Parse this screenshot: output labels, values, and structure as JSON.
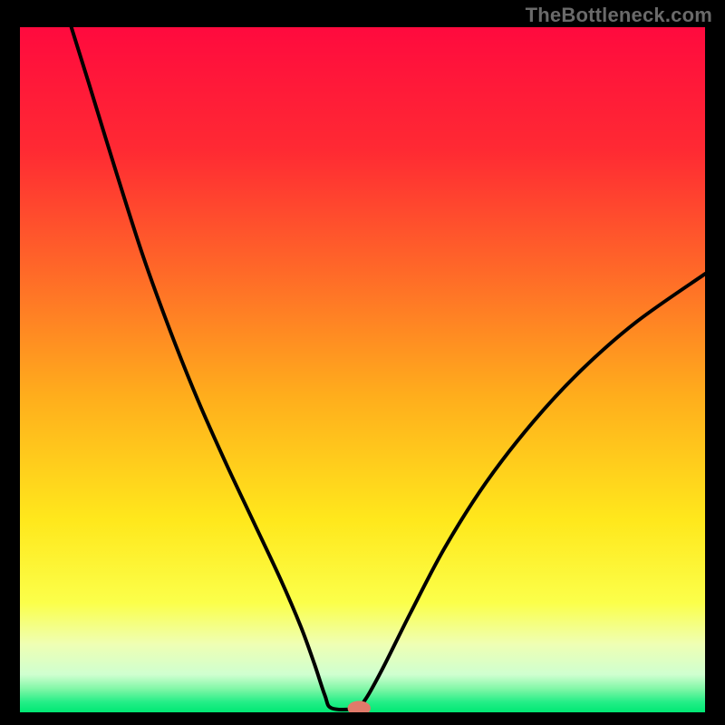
{
  "watermark": "TheBottleneck.com",
  "colors": {
    "frame_bg": "#000000",
    "gradient_stops": [
      {
        "offset": 0.0,
        "color": "#ff0a3e"
      },
      {
        "offset": 0.18,
        "color": "#ff2a33"
      },
      {
        "offset": 0.36,
        "color": "#ff6a28"
      },
      {
        "offset": 0.54,
        "color": "#ffae1c"
      },
      {
        "offset": 0.72,
        "color": "#ffe81c"
      },
      {
        "offset": 0.84,
        "color": "#fbff4a"
      },
      {
        "offset": 0.9,
        "color": "#efffb3"
      },
      {
        "offset": 0.945,
        "color": "#cfffd0"
      },
      {
        "offset": 0.965,
        "color": "#84f7a8"
      },
      {
        "offset": 0.985,
        "color": "#24ee87"
      },
      {
        "offset": 1.0,
        "color": "#00e874"
      }
    ],
    "curve_stroke": "#000000",
    "marker_fill": "#e07a6a",
    "marker_stroke": "#e07a6a"
  },
  "chart_data": {
    "type": "line",
    "title": "",
    "xlabel": "",
    "ylabel": "",
    "xlim": [
      0,
      100
    ],
    "ylim": [
      0,
      100
    ],
    "series": [
      {
        "name": "bottleneck-curve",
        "points": [
          {
            "x": 7.5,
            "y": 100.0
          },
          {
            "x": 10.0,
            "y": 92.0
          },
          {
            "x": 14.0,
            "y": 79.0
          },
          {
            "x": 18.0,
            "y": 66.5
          },
          {
            "x": 22.0,
            "y": 55.5
          },
          {
            "x": 26.0,
            "y": 45.5
          },
          {
            "x": 30.0,
            "y": 36.5
          },
          {
            "x": 34.0,
            "y": 28.0
          },
          {
            "x": 38.0,
            "y": 19.5
          },
          {
            "x": 41.0,
            "y": 12.5
          },
          {
            "x": 43.0,
            "y": 7.0
          },
          {
            "x": 44.5,
            "y": 2.5
          },
          {
            "x": 45.5,
            "y": 0.6
          },
          {
            "x": 49.0,
            "y": 0.6
          },
          {
            "x": 50.5,
            "y": 2.0
          },
          {
            "x": 53.0,
            "y": 6.5
          },
          {
            "x": 57.0,
            "y": 14.5
          },
          {
            "x": 62.0,
            "y": 24.0
          },
          {
            "x": 68.0,
            "y": 33.5
          },
          {
            "x": 75.0,
            "y": 42.5
          },
          {
            "x": 82.0,
            "y": 50.0
          },
          {
            "x": 90.0,
            "y": 57.0
          },
          {
            "x": 100.0,
            "y": 64.0
          }
        ]
      }
    ],
    "marker": {
      "x": 49.5,
      "y": 0.6,
      "rx": 1.6,
      "ry": 1.0
    },
    "grid": false,
    "legend": false
  }
}
